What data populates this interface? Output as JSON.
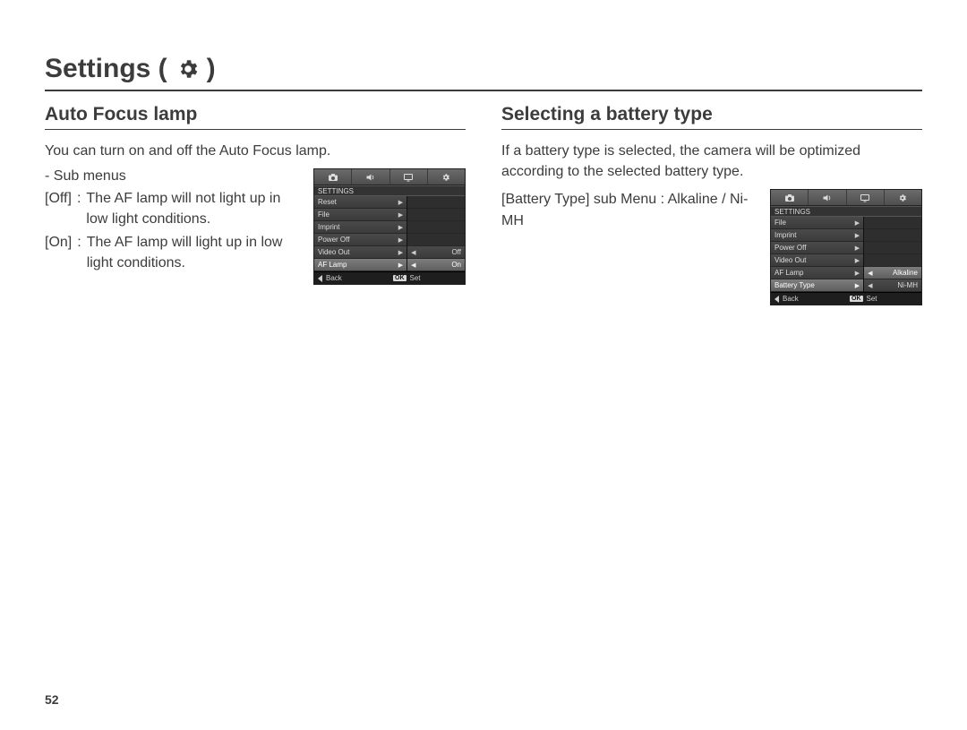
{
  "page_number": "52",
  "title": {
    "prefix": "Settings (",
    "suffix": ")"
  },
  "left": {
    "heading": "Auto Focus lamp",
    "intro": "You can turn on and off the Auto Focus lamp.",
    "sub_label": "- Sub menus",
    "defs": [
      {
        "key": "[Off]",
        "sep": ":",
        "val": "The AF lamp will not light up in low light conditions."
      },
      {
        "key": "[On]",
        "sep": ":",
        "val": "The AF lamp will light up in low light conditions."
      }
    ],
    "menu": {
      "header": "SETTINGS",
      "items": [
        "Reset",
        "File",
        "Imprint",
        "Power Off",
        "Video Out",
        "AF Lamp"
      ],
      "selected_index": 5,
      "sub_items": [
        "Off",
        "On"
      ],
      "sub_selected_index": 1,
      "footer": {
        "back": "Back",
        "ok": "OK",
        "set": "Set"
      }
    }
  },
  "right": {
    "heading": "Selecting a battery type",
    "intro": "If a battery type is selected, the camera will be optimized according to the selected battery type.",
    "sub_label": "[Battery Type] sub Menu : Alkaline / Ni-MH",
    "menu": {
      "header": "SETTINGS",
      "items": [
        "File",
        "Imprint",
        "Power Off",
        "Video Out",
        "AF Lamp",
        "Battery Type"
      ],
      "selected_index": 5,
      "sub_items": [
        "Alkaline",
        "Ni-MH"
      ],
      "sub_selected_index": 0,
      "footer": {
        "back": "Back",
        "ok": "OK",
        "set": "Set"
      }
    }
  }
}
